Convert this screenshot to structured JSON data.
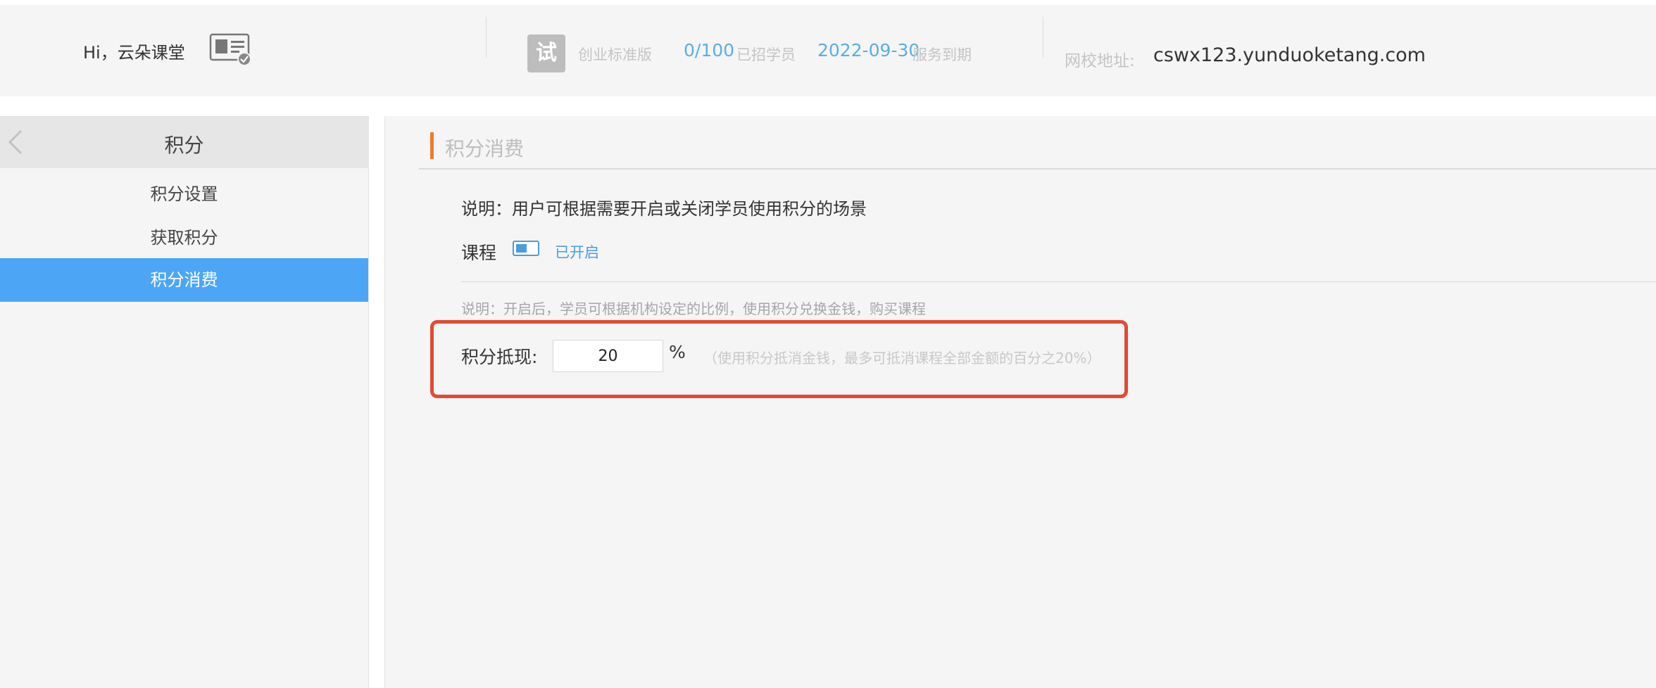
{
  "header": {
    "greeting": "Hi，云朵课堂",
    "trial_badge": "试",
    "plan": "创业标准版",
    "students_count": "0/100",
    "students_label": "已招学员",
    "expiry_date": "2022-09-30",
    "expiry_label": "服务到期",
    "site_label": "网校地址:",
    "site_url": "cswx123.yunduoketang.com"
  },
  "sidebar": {
    "title": "积分",
    "items": [
      {
        "label": "积分设置",
        "active": false
      },
      {
        "label": "获取积分",
        "active": false
      },
      {
        "label": "积分消费",
        "active": true
      }
    ]
  },
  "main": {
    "section_title": "积分消费",
    "description": "说明：用户可根据需要开启或关闭学员使用积分的场景",
    "course_label": "课程",
    "course_toggle_status": "已开启",
    "note": "说明：开启后，学员可根据机构设定的比例，使用积分兑换金钱，购买课程",
    "cash_label": "积分抵现:",
    "cash_value": "20",
    "cash_unit": "%",
    "cash_hint": "（使用积分抵消金钱，最多可抵消课程全部金额的百分之20%）"
  },
  "colors": {
    "accent_blue": "#4da6f5",
    "link_blue": "#4a9de0",
    "section_bar_orange": "#f07a28",
    "highlight_red": "#e24a33"
  }
}
